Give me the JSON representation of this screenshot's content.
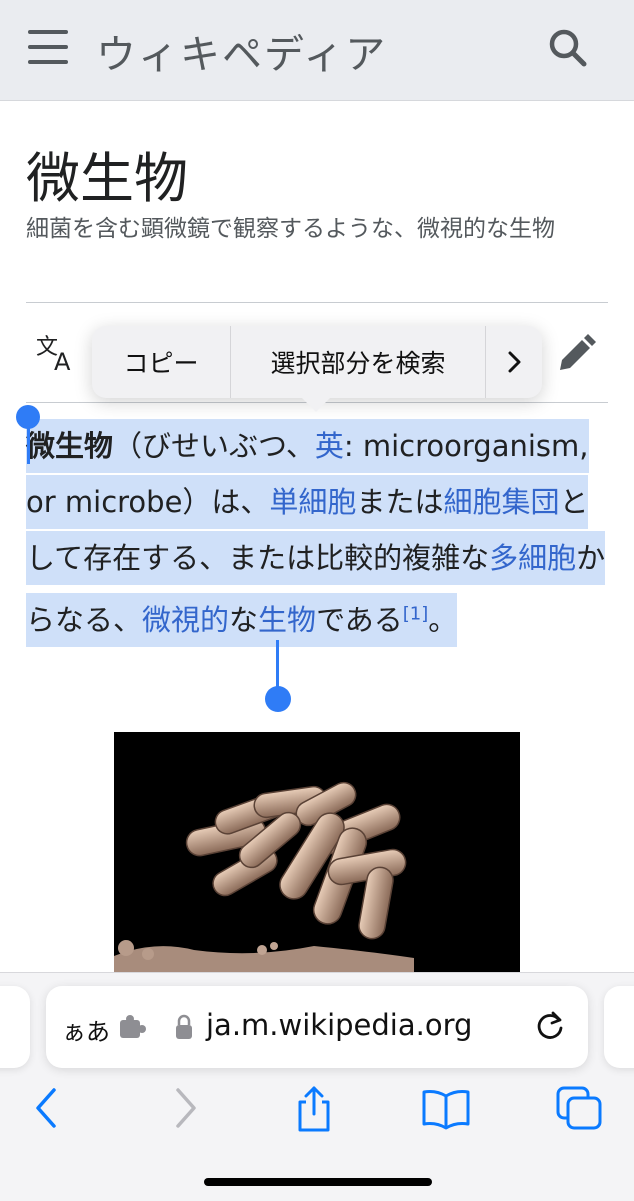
{
  "header": {
    "logo_text": "ウィキペディア",
    "menu_icon": "hamburger-menu-icon",
    "search_icon": "search-icon"
  },
  "article": {
    "title": "微生物",
    "subtitle": "細菌を含む顕微鏡で観察するような、微視的な生物",
    "body": {
      "bold_term": "微生物",
      "reading": "（びせいぶつ、",
      "lang_link": "英",
      "colon": ":",
      "english": "microorganism, or microbe）は、",
      "link_unicellular": "単細胞",
      "text_or": "または",
      "link_cell_colony": "細胞集団",
      "text_exist": "として存在する、または比較的複雑な",
      "link_multicellular": "多細胞",
      "text_consist": "からなる、",
      "link_microscopic": "微視的",
      "text_na": "な",
      "link_organism": "生物",
      "text_dearu": "である",
      "ref": "[1]",
      "period": "。"
    }
  },
  "context_menu": {
    "copy": "コピー",
    "lookup": "選択部分を検索",
    "more": "›"
  },
  "browser": {
    "aa_label": "ぁあ",
    "url": "ja.m.wikipedia.org",
    "icons": [
      "puzzle-icon",
      "lock-icon",
      "reload-icon",
      "back-icon",
      "forward-icon",
      "share-icon",
      "bookmarks-icon",
      "tabs-icon"
    ]
  },
  "colors": {
    "link": "#3366cc",
    "selection": "#cfe0f9",
    "handle": "#2f7cf6",
    "ios_blue": "#0a7aff"
  }
}
